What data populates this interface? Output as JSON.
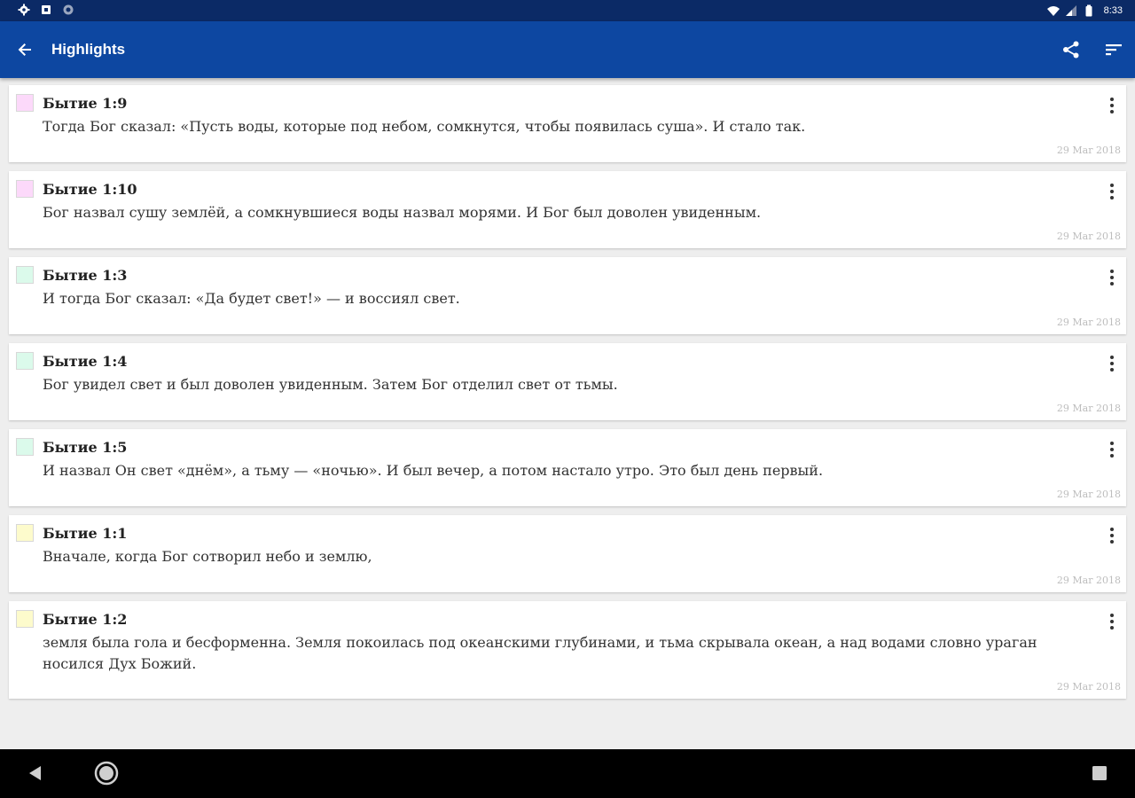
{
  "status_bar": {
    "left_icons": [
      "settings-icon",
      "sim-card-icon",
      "sync-icon"
    ],
    "right_icons": [
      "wifi-icon",
      "signal-icon",
      "battery-icon"
    ],
    "time": "8:33"
  },
  "app_bar": {
    "title": "Highlights",
    "back_icon": "arrow-left-icon",
    "actions": [
      "share-icon",
      "sort-icon"
    ],
    "color": "#0d47a1"
  },
  "highlights": [
    {
      "reference": "Бытие 1:9",
      "text": "Тогда Бог сказал: «Пусть воды, которые под небом, сомкнутся, чтобы появилась суша». И стало так.",
      "date": "29 Mar 2018",
      "color": "#fcd9fa"
    },
    {
      "reference": "Бытие 1:10",
      "text": "Бог назвал сушу землёй, а сомкнувшиеся воды назвал морями. И Бог был доволен увиденным.",
      "date": "29 Mar 2018",
      "color": "#fcd9fa"
    },
    {
      "reference": "Бытие 1:3",
      "text": "И тогда Бог сказал: «Да будет свет!» — и воссиял свет.",
      "date": "29 Mar 2018",
      "color": "#dbfaeb"
    },
    {
      "reference": "Бытие 1:4",
      "text": "Бог увидел свет и был доволен увиденным. Затем Бог отделил свет от тьмы.",
      "date": "29 Mar 2018",
      "color": "#dbfaeb"
    },
    {
      "reference": "Бытие 1:5",
      "text": "И назвал Он свет «днём», а тьму — «ночью». И был вечер, а потом настало утро. Это был день первый.",
      "date": "29 Mar 2018",
      "color": "#dbfaeb"
    },
    {
      "reference": "Бытие 1:1",
      "text": "Вначале, когда Бог сотворил небо и землю,",
      "date": "29 Mar 2018",
      "color": "#fdfbcc"
    },
    {
      "reference": "Бытие 1:2",
      "text": "земля была гола и бесформенна. Земля покоилась под океанскими глубинами, и тьма скрывала океан, а над водами словно ураган носился Дух Божий.",
      "date": "29 Mar 2018",
      "color": "#fdfbcc"
    }
  ],
  "nav_bar": {
    "icons": [
      "nav-back-icon",
      "nav-home-icon",
      "nav-recents-icon"
    ]
  }
}
